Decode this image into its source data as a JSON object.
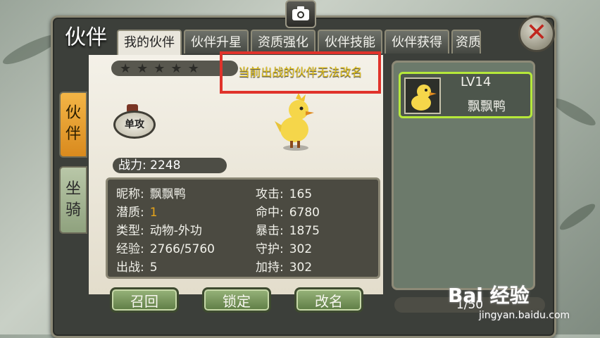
{
  "window": {
    "title": "伙伴",
    "camera_icon": "camera-icon",
    "close_icon": "close-x-icon"
  },
  "tabs": [
    {
      "label": "我的伙伴",
      "active": true
    },
    {
      "label": "伙伴升星",
      "active": false
    },
    {
      "label": "资质强化",
      "active": false
    },
    {
      "label": "伙伴技能",
      "active": false
    },
    {
      "label": "伙伴获得",
      "active": false
    },
    {
      "label": "资质",
      "active": false
    }
  ],
  "side_tabs": [
    {
      "label": "伙\n伴",
      "active": true
    },
    {
      "label": "坐\n骑",
      "active": false
    }
  ],
  "partner": {
    "stars_total": 5,
    "stars_filled": 0,
    "attack_type_badge": "单攻",
    "power_label": "战力:",
    "power_value": "2248",
    "stats_left": [
      {
        "key": "昵称:",
        "value": "飘飘鸭",
        "highlight": false
      },
      {
        "key": "潜质:",
        "value": "1",
        "highlight": true
      },
      {
        "key": "类型:",
        "value": "动物-外功",
        "highlight": false
      },
      {
        "key": "经验:",
        "value": "2766/5760",
        "highlight": false
      },
      {
        "key": "出战:",
        "value": "5",
        "highlight": false
      }
    ],
    "stats_right": [
      {
        "key": "攻击:",
        "value": "165"
      },
      {
        "key": "命中:",
        "value": "6780"
      },
      {
        "key": "暴击:",
        "value": "1875"
      },
      {
        "key": "守护:",
        "value": "302"
      },
      {
        "key": "加持:",
        "value": "302"
      }
    ]
  },
  "toast": "当前出战的伙伴无法改名",
  "buttons": {
    "recall": "召回",
    "lock": "锁定",
    "rename": "改名"
  },
  "partner_list": {
    "items": [
      {
        "level": "LV14",
        "name": "飘飘鸭",
        "selected": true
      }
    ],
    "page": "1/50"
  },
  "watermark": {
    "main": "Bai  经验",
    "sub": "jingyan.baidu.com"
  },
  "colors": {
    "accent_green": "#b6e83a",
    "highlight_orange": "#e6a41a",
    "toast_yellow": "#e4c21a",
    "toast_border_red": "#e0332b"
  }
}
